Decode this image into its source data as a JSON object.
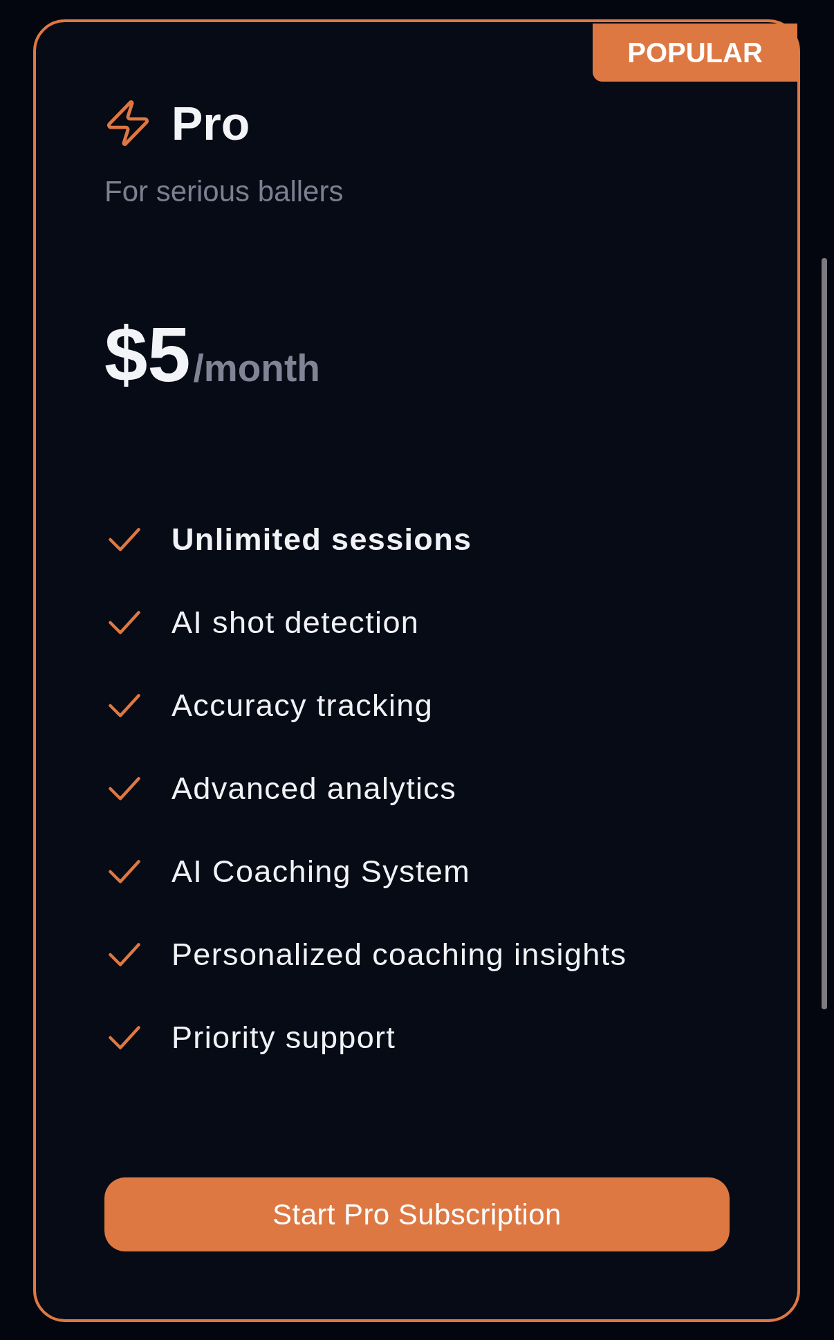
{
  "plan": {
    "badge": "POPULAR",
    "name": "Pro",
    "tagline": "For serious ballers",
    "price": {
      "amount": "$5",
      "period": "/month"
    },
    "features": [
      {
        "text": "Unlimited sessions",
        "highlighted": true
      },
      {
        "text": "AI shot detection",
        "highlighted": false
      },
      {
        "text": "Accuracy tracking",
        "highlighted": false
      },
      {
        "text": "Advanced analytics",
        "highlighted": false
      },
      {
        "text": "AI Coaching System",
        "highlighted": false
      },
      {
        "text": "Personalized coaching insights",
        "highlighted": false
      },
      {
        "text": "Priority support",
        "highlighted": false
      }
    ],
    "cta": "Start Pro Subscription"
  }
}
